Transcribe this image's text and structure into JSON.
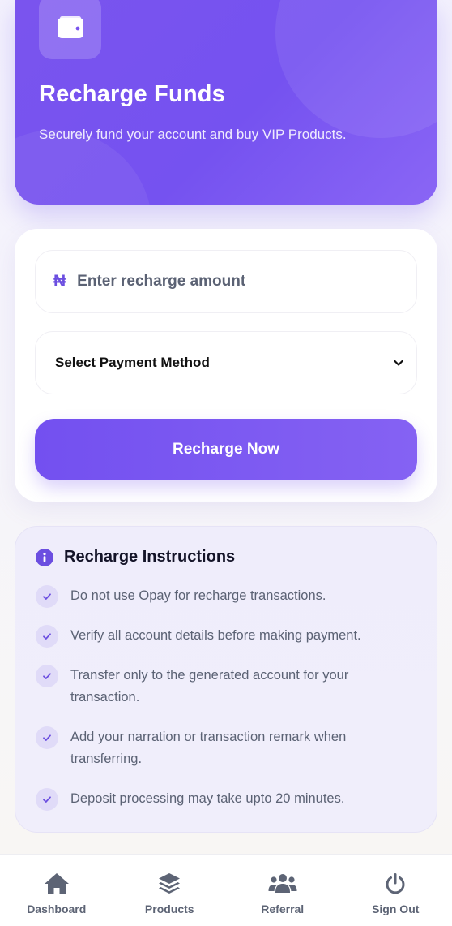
{
  "hero": {
    "title": "Recharge Funds",
    "subtitle": "Securely fund your account and buy VIP Products.",
    "icon": "wallet-icon"
  },
  "form": {
    "currency_symbol": "₦",
    "amount_placeholder": "Enter recharge amount",
    "amount_value": "",
    "payment_method_selected": "Select Payment Method",
    "submit_label": "Recharge Now"
  },
  "instructions": {
    "title": "Recharge Instructions",
    "items": [
      "Do not use Opay for recharge transactions.",
      "Verify all account details before making payment.",
      "Transfer only to the generated account for your transaction.",
      "Add your narration or transaction remark when transferring.",
      "Deposit processing may take upto 20 minutes."
    ]
  },
  "nav": {
    "items": [
      {
        "label": "Dashboard",
        "icon": "home-icon"
      },
      {
        "label": "Products",
        "icon": "layers-icon"
      },
      {
        "label": "Referral",
        "icon": "users-icon"
      },
      {
        "label": "Sign Out",
        "icon": "power-icon"
      }
    ]
  },
  "colors": {
    "accent": "#7352f0",
    "accent_light": "#e0dbf8",
    "muted_text": "#5b6274"
  }
}
